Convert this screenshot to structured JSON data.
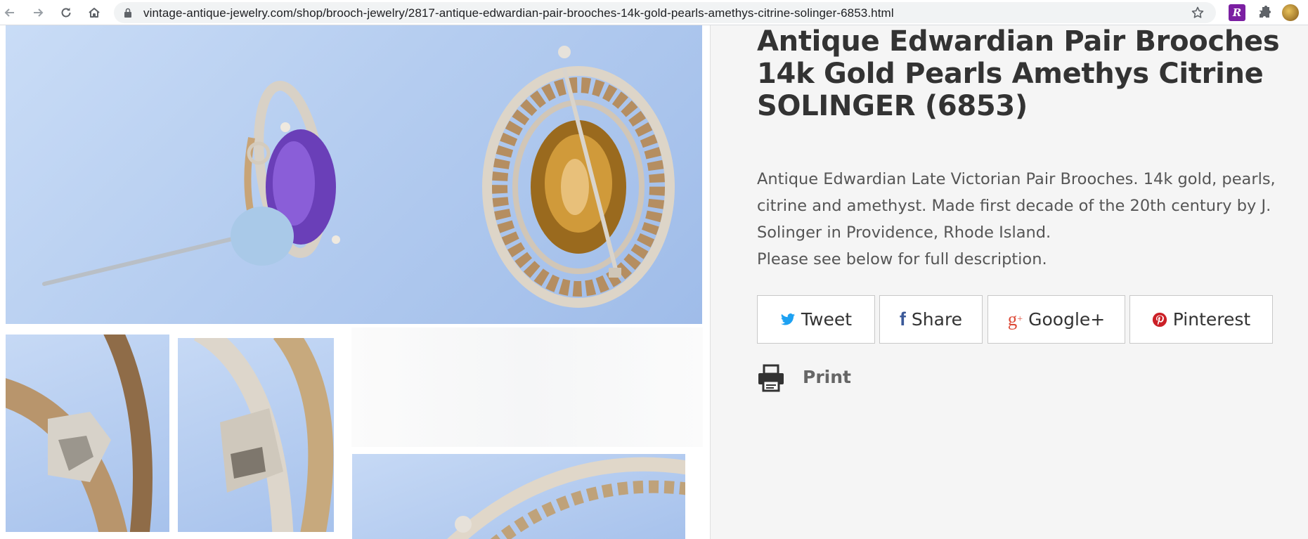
{
  "browser": {
    "url": "vintage-antique-jewelry.com/shop/brooch-jewelry/2817-antique-edwardian-pair-brooches-14k-gold-pearls-amethys-citrine-solinger-6853.html",
    "back_icon": "back-arrow-icon",
    "forward_icon": "forward-arrow-icon",
    "reload_icon": "reload-icon",
    "home_icon": "home-icon",
    "lock_icon": "lock-icon",
    "bookmark_icon": "star-icon",
    "extension_label": "R",
    "extensions_icon": "puzzle-icon",
    "colors": {
      "toolbar": "#ffffff",
      "omnibox": "#f1f3f4",
      "extension_bg": "#7b1fa2"
    }
  },
  "product": {
    "title": "Antique Edwardian Pair Brooches 14k Gold Pearls Amethys Citrine SOLINGER (6853)",
    "description_lines": [
      "Antique Edwardian Late Victorian Pair Brooches. 14k gold, pearls, citrine and amethyst. Made first decade of the 20th century by J. Solinger in Providence, Rhode Island.",
      "Please see below for full description."
    ]
  },
  "share": {
    "tweet_label": "Tweet",
    "share_label": "Share",
    "google_label": "Google+",
    "pinterest_label": "Pinterest",
    "colors": {
      "twitter": "#1da1f2",
      "facebook": "#3b5998",
      "google": "#dd4b39",
      "pinterest": "#cb2027"
    }
  },
  "print": {
    "label": "Print",
    "icon": "printer-icon"
  },
  "gallery": {
    "main_image": "brooch-pair-photo",
    "thumbnails": [
      "hallmark-closeup-1",
      "hallmark-closeup-2",
      "brooch-frame-closeup"
    ]
  }
}
